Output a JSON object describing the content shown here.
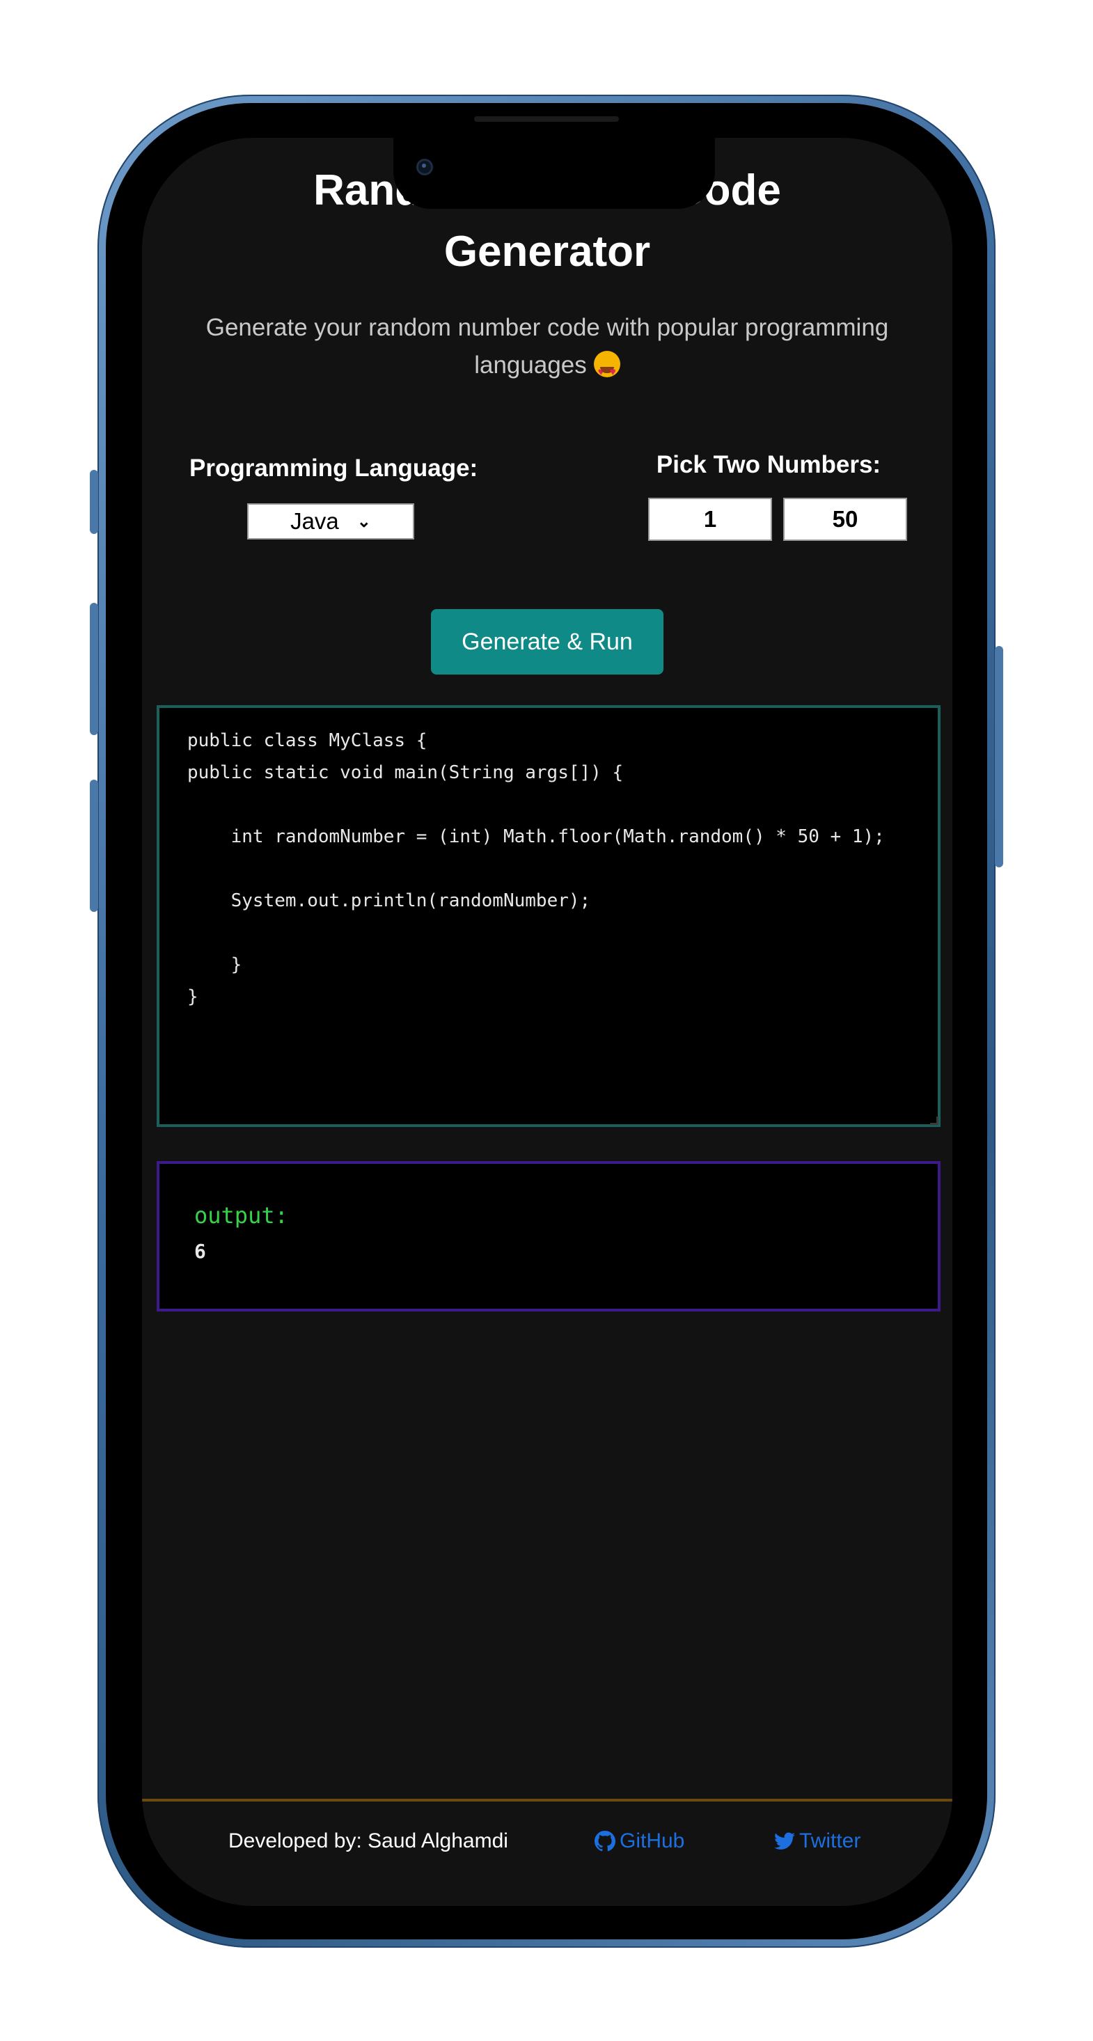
{
  "header": {
    "title_line1": "Random Number Code",
    "title_line2": "Generator",
    "subtitle": "Generate your random number code with popular programming languages"
  },
  "controls": {
    "language_label": "Programming Language:",
    "language_selected": "Java",
    "numbers_label": "Pick Two Numbers:",
    "min_value": "1",
    "max_value": "50",
    "generate_button": "Generate & Run"
  },
  "code": {
    "text": "public class MyClass {\npublic static void main(String args[]) {\n\n    int randomNumber = (int) Math.floor(Math.random() * 50 + 1);\n\n    System.out.println(randomNumber);\n\n    }\n}"
  },
  "output": {
    "label": "output:",
    "value": "6"
  },
  "footer": {
    "developer": "Developed by: Saud Alghamdi",
    "github": "GitHub",
    "twitter": "Twitter"
  },
  "colors": {
    "background": "#121212",
    "accent_button": "#0f8a86",
    "code_border": "#1b5f5a",
    "output_border": "#3c1a8a",
    "output_label": "#35d24a",
    "link": "#1d6fe0",
    "footer_divider": "#6b4a12",
    "phone_frame": "#3c6a9c"
  },
  "icons": [
    "smiling-face-with-heart-eyes-emoji",
    "chevron-down-icon",
    "github-icon",
    "twitter-icon"
  ]
}
